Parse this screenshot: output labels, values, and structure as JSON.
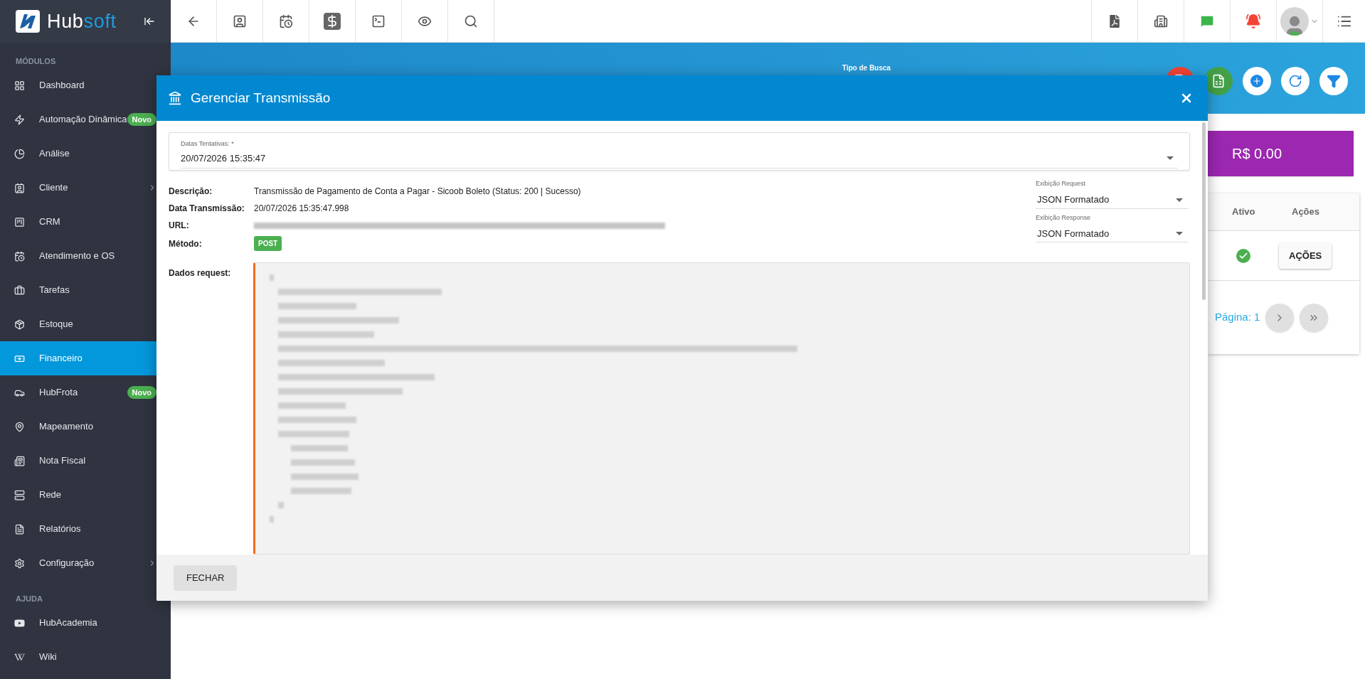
{
  "sidebar": {
    "brand": "Hub",
    "brand_accent": "soft",
    "sections": [
      {
        "heading": "MÓDULOS",
        "items": [
          {
            "label": "Dashboard",
            "selected": false,
            "submenu": false
          },
          {
            "label": "Automação Dinâmica",
            "selected": false,
            "submenu": false,
            "badge": "Novo"
          },
          {
            "label": "Análise",
            "selected": false,
            "submenu": false
          },
          {
            "label": "Cliente",
            "selected": false,
            "submenu": true
          },
          {
            "label": "CRM",
            "selected": false,
            "submenu": false
          },
          {
            "label": "Atendimento e OS",
            "selected": false,
            "submenu": false
          },
          {
            "label": "Tarefas",
            "selected": false,
            "submenu": false
          },
          {
            "label": "Estoque",
            "selected": false,
            "submenu": false
          },
          {
            "label": "Financeiro",
            "selected": true,
            "submenu": false
          },
          {
            "label": "HubFrota",
            "selected": false,
            "submenu": false,
            "badge": "Novo"
          },
          {
            "label": "Mapeamento",
            "selected": false,
            "submenu": false
          },
          {
            "label": "Nota Fiscal",
            "selected": false,
            "submenu": false
          },
          {
            "label": "Rede",
            "selected": false,
            "submenu": false
          },
          {
            "label": "Relatórios",
            "selected": false,
            "submenu": false
          },
          {
            "label": "Configuração",
            "selected": false,
            "submenu": true
          }
        ]
      },
      {
        "heading": "AJUDA",
        "items": [
          {
            "label": "HubAcademia",
            "selected": false,
            "submenu": false
          },
          {
            "label": "Wiki",
            "selected": false,
            "submenu": false
          }
        ]
      }
    ]
  },
  "page": {
    "search_type_label": "Tipo de Busca",
    "total": "R$ 0.00",
    "table": {
      "columns": [
        "Ativo",
        "Ações"
      ],
      "rows": [
        {
          "active": true,
          "action": "AÇÕES"
        }
      ]
    },
    "pagination": "Página: 1"
  },
  "modal": {
    "title": "Gerenciar Transmissão",
    "attempt_dates": {
      "label": "Datas Tentativas: *",
      "value": "20/07/2026 15:35:47"
    },
    "details": [
      {
        "label": "Descrição:",
        "kind": "text",
        "value": "Transmissão de Pagamento de Conta a Pagar - Sicoob Boleto (Status: 200 | Sucesso)"
      },
      {
        "label": "Data Transmissão:",
        "kind": "text",
        "value": "20/07/2026 15:35:47.998"
      },
      {
        "label": "URL:",
        "kind": "redacted"
      },
      {
        "label": "Método:",
        "kind": "badge",
        "value": "POST"
      }
    ],
    "views": [
      {
        "label": "Exibição Request",
        "value": "JSON Formatado"
      },
      {
        "label": "Exibição Response",
        "value": "JSON Formatado"
      }
    ],
    "request_data_label": "Dados request:",
    "close_button": "FECHAR"
  }
}
